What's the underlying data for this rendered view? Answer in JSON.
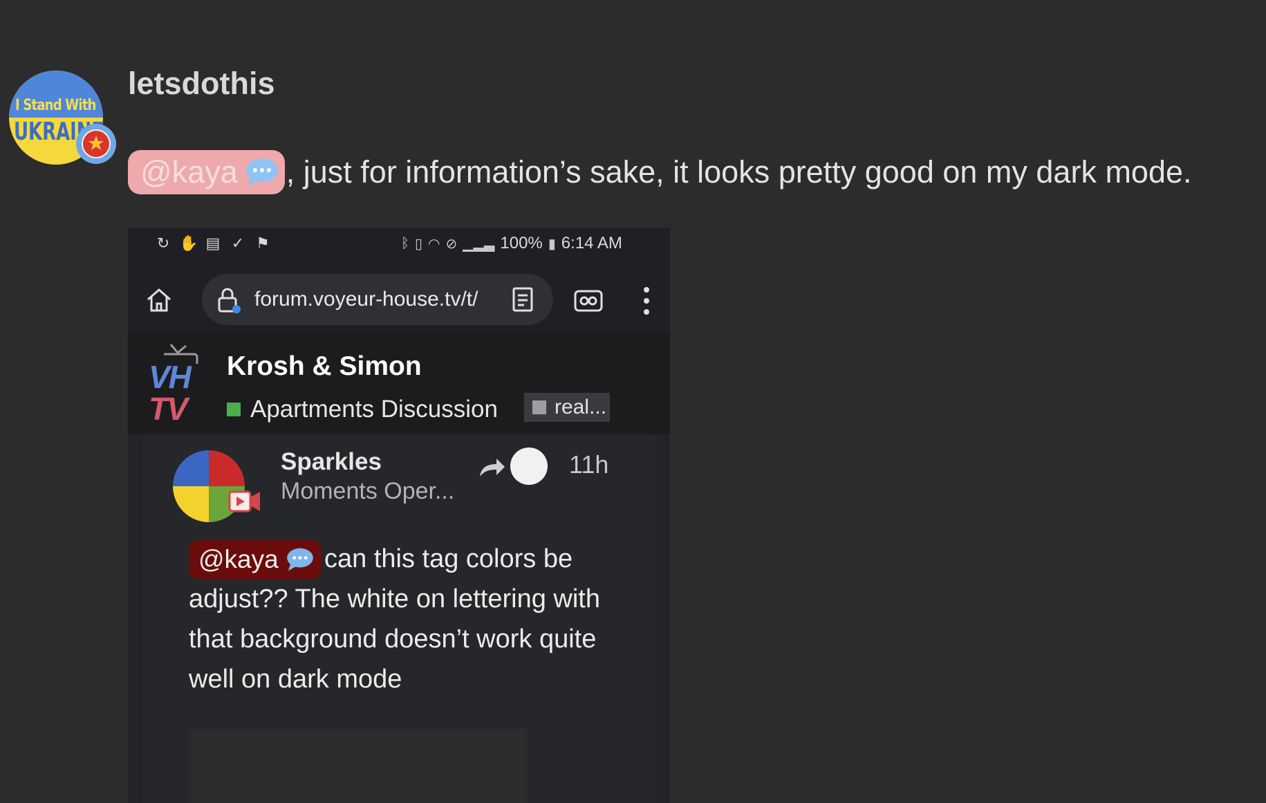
{
  "post": {
    "username": "letsdothis",
    "avatar": {
      "line1": "I Stand With",
      "line2": "UKRAINE"
    },
    "mention": "@kaya",
    "text": ", just for information’s sake, it looks pretty good on my dark mode."
  },
  "screenshot": {
    "status_bar": {
      "battery": "100%",
      "time": "6:14 AM"
    },
    "url": "forum.voyeur-house.tv/t/",
    "forum": {
      "logo_top": "VH",
      "logo_bottom": "TV",
      "topic_title": "Krosh & Simon",
      "category": "Apartments Discussion",
      "category_color": "#47b04b",
      "tag": "real..."
    },
    "reply": {
      "author": "Sparkles",
      "subtitle": "Moments Oper...",
      "time": "11h",
      "mention": "@kaya",
      "body": "can this tag colors be adjust?? The white on lettering with that background doesn’t work quite well on dark mode"
    }
  },
  "colors": {
    "background": "#2c2c2c",
    "mention_bg": "#eea9ad",
    "inner_mention_bg": "#6a0c0c"
  }
}
